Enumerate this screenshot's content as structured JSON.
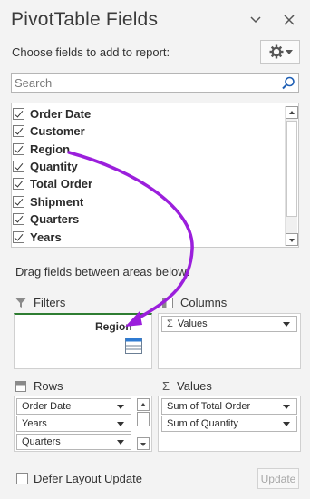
{
  "header": {
    "title": "PivotTable Fields",
    "choose_text": "Choose fields to add to report:"
  },
  "search": {
    "placeholder": "Search",
    "value": ""
  },
  "fields": [
    {
      "label": "Order Date",
      "checked": true
    },
    {
      "label": "Customer",
      "checked": true
    },
    {
      "label": "Region",
      "checked": true
    },
    {
      "label": "Quantity",
      "checked": true
    },
    {
      "label": "Total Order",
      "checked": true
    },
    {
      "label": "Shipment",
      "checked": true
    },
    {
      "label": "Quarters",
      "checked": true
    },
    {
      "label": "Years",
      "checked": true
    }
  ],
  "drag_hint": "Drag fields between areas below:",
  "areas": {
    "filters": {
      "label": "Filters",
      "dropped_field": "Region"
    },
    "columns": {
      "label": "Columns",
      "items": [
        "Values"
      ]
    },
    "rows": {
      "label": "Rows",
      "items": [
        "Order Date",
        "Years",
        "Quarters"
      ]
    },
    "values": {
      "label": "Values",
      "items": [
        "Sum of Total Order",
        "Sum of Quantity"
      ]
    }
  },
  "footer": {
    "defer_label": "Defer Layout Update",
    "update_label": "Update"
  },
  "colors": {
    "annotation_arrow": "#9b1fdc"
  },
  "icons": {
    "dropdown": "chevron-down-icon",
    "close": "close-icon",
    "settings": "gear-icon",
    "search": "search-icon",
    "filter": "filter-icon",
    "columns": "columns-icon",
    "rows": "rows-icon",
    "values": "sigma-icon"
  }
}
